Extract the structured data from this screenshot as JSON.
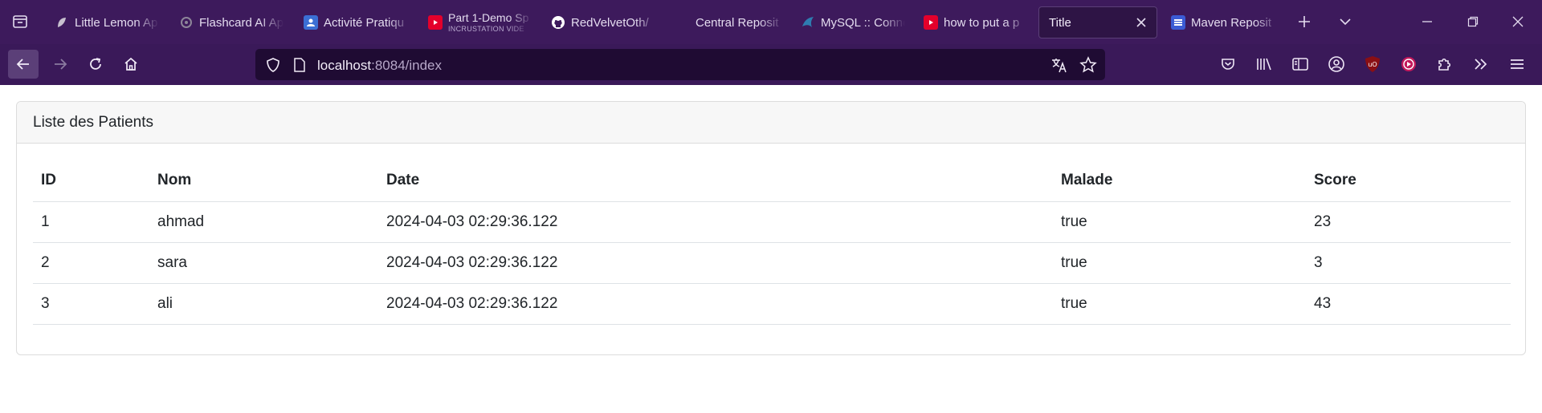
{
  "browser": {
    "tabs": [
      {
        "title": "Little Lemon Ap",
        "icon": "little-lemon-icon",
        "icon_color": "#c7c0cf"
      },
      {
        "title": "Flashcard AI Ap",
        "icon": "openai-icon",
        "icon_color": "#8d8599"
      },
      {
        "title": "Activité Pratiqu",
        "icon": "classroom-icon",
        "icon_color": "#3b6fd4"
      },
      {
        "title": "Part 1-Demo Sp",
        "subtitle": "INCRUSTATION VIDÉ",
        "icon": "youtube-icon",
        "icon_color": "#e4002b"
      },
      {
        "title": "RedVelvetOth/",
        "icon": "github-icon",
        "icon_color": "#ffffff"
      },
      {
        "title": "Central Reposit",
        "icon": "",
        "icon_color": ""
      },
      {
        "title": "MySQL :: Conne",
        "icon": "mysql-icon",
        "icon_color": "#2e7cb0"
      },
      {
        "title": "how to put a p",
        "icon": "youtube-icon",
        "icon_color": "#e4002b"
      },
      {
        "title": "Title",
        "icon": "",
        "icon_color": "",
        "active": true
      },
      {
        "title": "Maven Reposit",
        "icon": "maven-icon",
        "icon_color": "#3b5bd4"
      }
    ],
    "url": {
      "host": "localhost",
      "rest": ":8084/index"
    }
  },
  "page": {
    "card_title": "Liste des Patients",
    "table": {
      "headers": [
        "ID",
        "Nom",
        "Date",
        "Malade",
        "Score"
      ],
      "rows": [
        [
          "1",
          "ahmad",
          "2024-04-03 02:29:36.122",
          "true",
          "23"
        ],
        [
          "2",
          "sara",
          "2024-04-03 02:29:36.122",
          "true",
          "3"
        ],
        [
          "3",
          "ali",
          "2024-04-03 02:29:36.122",
          "true",
          "43"
        ]
      ]
    }
  },
  "colors": {
    "tabstrip_bg": "#3d1a5c",
    "navbar_bg": "#3a1959",
    "urlbar_bg": "#1f0b33",
    "card_header_bg": "#f7f7f7"
  }
}
